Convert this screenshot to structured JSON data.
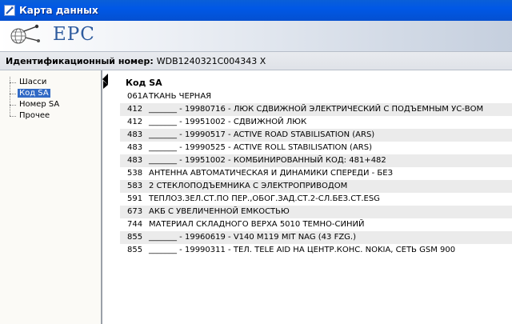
{
  "window": {
    "title": "Карта данных"
  },
  "banner": {
    "logo_text": "EPC"
  },
  "id_bar": {
    "label": "Идентификационный номер:",
    "value": "WDB1240321C004343 X"
  },
  "tree": {
    "items": [
      {
        "label": "Шасси",
        "selected": false
      },
      {
        "label": "Код SA",
        "selected": true
      },
      {
        "label": "Номер SA",
        "selected": false
      },
      {
        "label": "Прочее",
        "selected": false
      }
    ]
  },
  "content": {
    "header": "Код SA",
    "rows": [
      {
        "code": "061A",
        "text": "ТКАНЬ ЧЕРНАЯ"
      },
      {
        "code": "412",
        "text": "_______  -  19980716  -  ЛЮК СДВИЖНОЙ ЭЛЕКТРИЧЕСКИЙ С ПОДЪЕМНЫМ УС-ВОМ"
      },
      {
        "code": "412",
        "text": "_______  -  19951002  -  СДВИЖНОЙ ЛЮК"
      },
      {
        "code": "483",
        "text": "_______  -  19990517  -  ACTIVE ROAD STABILISATION (ARS)"
      },
      {
        "code": "483",
        "text": "_______  -  19990525  -  ACTIVE ROLL STABILISATION (ARS)"
      },
      {
        "code": "483",
        "text": "_______  -  19951002  -  КОМБИНИРОВАННЫЙ КОД: 481+482"
      },
      {
        "code": "538",
        "text": "АНТЕННА АВТОМАТИЧЕСКАЯ И ДИНАМИКИ СПЕРЕДИ - БЕЗ"
      },
      {
        "code": "583",
        "text": "2 СТЕКЛОПОДЪЕМНИКА С ЭЛЕКТРОПРИВОДОМ"
      },
      {
        "code": "591",
        "text": "ТЕПЛОЗ.ЗЕЛ.СТ.ПО ПЕР.,ОБОГ.ЗАД.СТ.2-СЛ.БЕЗ.СТ.ESG"
      },
      {
        "code": "673",
        "text": "АКБ С УВЕЛИЧЕННОЙ ЕМКОСТЬЮ"
      },
      {
        "code": "744",
        "text": "МАТЕРИАЛ СКЛАДНОГО ВЕРХА 5010 ТЕМНО-СИНИЙ"
      },
      {
        "code": "855",
        "text": "_______  -  19960619  -  V140 M119 MIT NAG (43 FZG.)"
      },
      {
        "code": "855",
        "text": "_______  -  19990311  -  ТЕЛ. TELE AID НА ЦЕНТР.КОНС. NOKIA, СЕТЬ GSM 900"
      }
    ]
  },
  "colors": {
    "titlebar": "#0058e6",
    "selection": "#316ac5",
    "logo_text": "#2e5b9e",
    "row_alt": "#ebebeb"
  },
  "icons": {
    "app": "app-window-icon",
    "logo": "epc-globe-logo-icon"
  }
}
